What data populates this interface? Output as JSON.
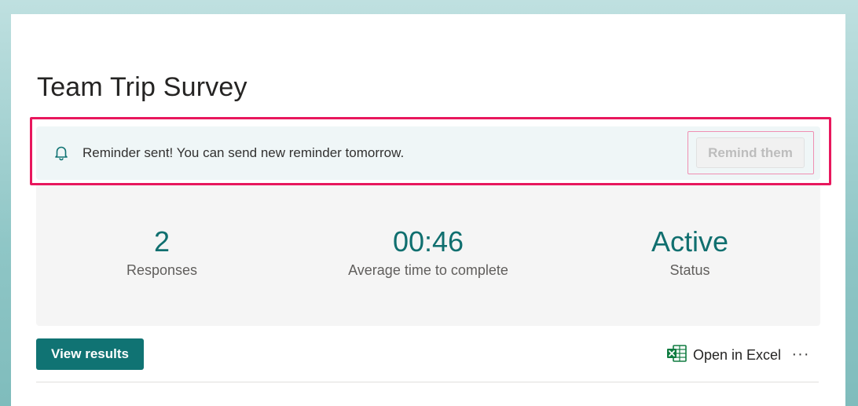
{
  "form": {
    "title": "Team Trip Survey"
  },
  "banner": {
    "icon": "bell-icon",
    "message": "Reminder sent! You can send new reminder tomorrow.",
    "remind_label": "Remind them"
  },
  "stats": [
    {
      "value": "2",
      "label": "Responses"
    },
    {
      "value": "00:46",
      "label": "Average time to complete"
    },
    {
      "value": "Active",
      "label": "Status"
    }
  ],
  "actions": {
    "view_results_label": "View results",
    "open_excel_label": "Open in Excel",
    "excel_icon": "excel-icon",
    "more_icon": "more-icon",
    "more_glyph": "···"
  },
  "colors": {
    "accent": "#107373",
    "highlight": "#e8175d"
  }
}
